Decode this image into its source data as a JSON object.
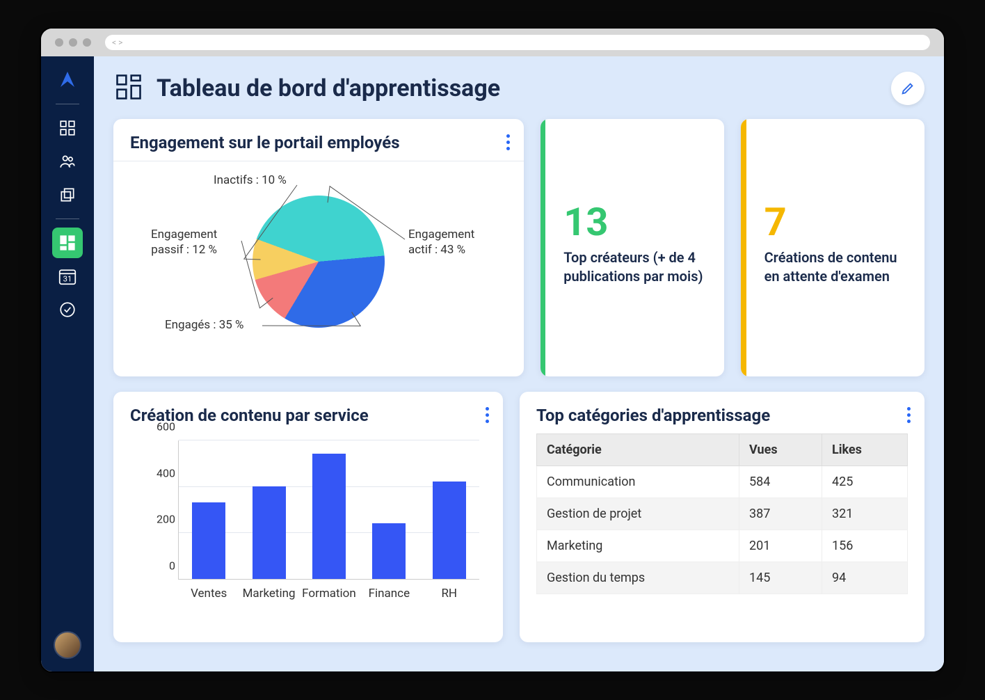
{
  "header": {
    "title": "Tableau de bord d'apprentissage"
  },
  "sidebar": {
    "calendar_day": "31"
  },
  "cards": {
    "engagement": {
      "title": "Engagement sur le portail employés"
    },
    "stat_green": {
      "value": "13",
      "label": "Top créateurs (+ de 4 publications par mois)"
    },
    "stat_amber": {
      "value": "7",
      "label": "Créations de contenu en attente d'examen"
    },
    "bar": {
      "title": "Création de contenu par service"
    },
    "table": {
      "title": "Top catégories d'apprentissage",
      "headers": {
        "cat": "Catégorie",
        "views": "Vues",
        "likes": "Likes"
      },
      "rows": [
        {
          "cat": "Communication",
          "views": "584",
          "likes": "425"
        },
        {
          "cat": "Gestion de projet",
          "views": "387",
          "likes": "321"
        },
        {
          "cat": "Marketing",
          "views": "201",
          "likes": "156"
        },
        {
          "cat": "Gestion du temps",
          "views": "145",
          "likes": "94"
        }
      ]
    }
  },
  "chart_data": [
    {
      "type": "pie",
      "title": "Engagement sur le portail employés",
      "series": [
        {
          "name": "Engagement actif",
          "value": 43,
          "label": "Engagement actif : 43 %",
          "color": "#3fd3cf"
        },
        {
          "name": "Engagés",
          "value": 35,
          "label": "Engagés : 35 %",
          "color": "#2f6be8"
        },
        {
          "name": "Engagement passif",
          "value": 12,
          "label": "Engagement passif : 12 %",
          "color": "#f37a7a"
        },
        {
          "name": "Inactifs",
          "value": 10,
          "label": "Inactifs : 10 %",
          "color": "#f7cf60"
        }
      ]
    },
    {
      "type": "bar",
      "title": "Création de contenu par service",
      "categories": [
        "Ventes",
        "Marketing",
        "Formation",
        "Finance",
        "RH"
      ],
      "values": [
        330,
        400,
        540,
        240,
        420
      ],
      "ylim": [
        0,
        600
      ],
      "y_ticks": [
        0,
        200,
        400,
        600
      ],
      "color": "#3556f5"
    }
  ]
}
